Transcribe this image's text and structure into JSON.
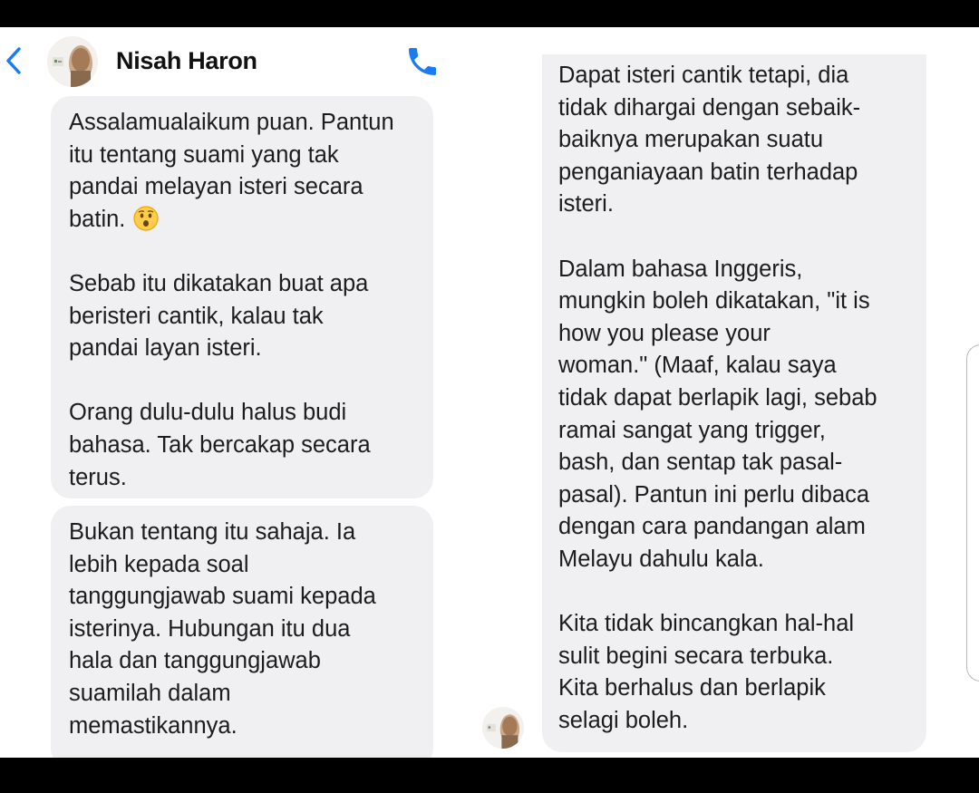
{
  "header": {
    "back_icon": "chevron-left-icon",
    "contact_name": "Nisah Haron",
    "call_icon": "phone-icon",
    "accent_color": "#1a7cf4"
  },
  "messages": {
    "b1_p1": "Assalamualaikum puan. Pantun\nitu tentang suami yang tak\npandai melayan isteri secara\nbatin.",
    "b1_emoji": "hushed-face-emoji",
    "b1_p2": "Sebab itu dikatakan buat apa\nberisteri cantik, kalau tak\npandai layan isteri.",
    "b1_p3": "Orang dulu-dulu halus budi\nbahasa. Tak bercakap secara\nterus.",
    "b2_p1": "Bukan tentang itu sahaja. Ia\nlebih kepada soal\ntanggungjawab suami kepada\nisterinya. Hubungan itu dua\nhala dan tanggungjawab\nsuamilah dalam\nmemastikannya.",
    "b3_p1": "Dapat isteri cantik tetapi, dia\ntidak dihargai dengan sebaik-\nbaiknya merupakan suatu\npenganiayaan batin terhadap\nisteri.",
    "b3_p2": "Dalam bahasa Inggeris,\nmungkin boleh dikatakan, \"it is\nhow you please your\nwoman.\" (Maaf, kalau saya\ntidak dapat berlapik lagi, sebab\nramai sangat yang trigger,\nbash, dan sentap tak pasal-\npasal). Pantun ini perlu dibaca\ndengan cara pandangan alam\nMelayu dahulu kala.",
    "b3_p3": "Kita tidak bincangkan hal-hal\nsulit begini secara terbuka.\nKita berhalus dan berlapik\nselagi boleh."
  }
}
